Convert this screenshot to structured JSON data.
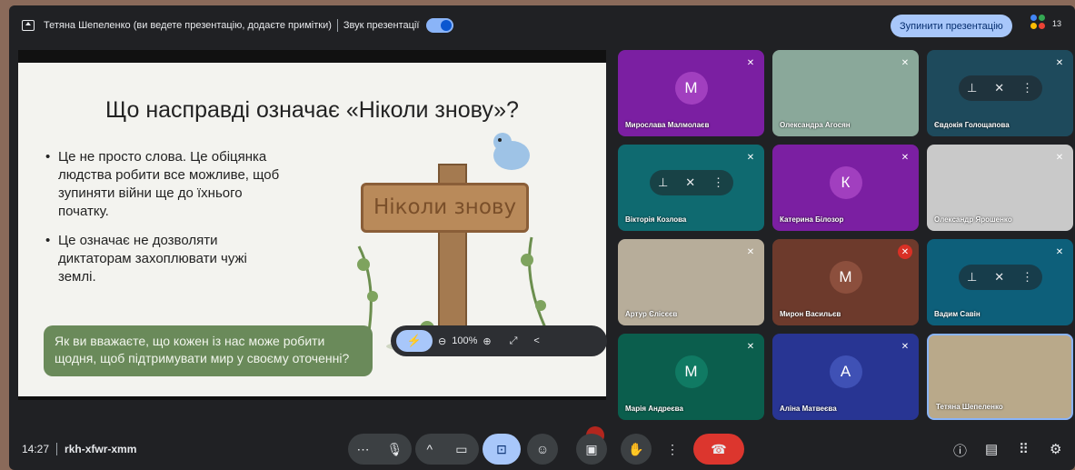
{
  "topbar": {
    "presenter_text": "Тетяна Шепеленко (ви ведете презентацію, додаєте примітки)",
    "sound_label": "Звук презентації",
    "stop_button": "Зупинити презентацію",
    "participant_count": "13"
  },
  "slide": {
    "title": "Що насправді означає «Ніколи знову»?",
    "bullets": [
      "Це не просто слова. Це обіцянка людства робити все можливе, щоб зупиняти війни ще до їхнього початку.",
      "Це означає не дозволяти диктаторам захоплювати чужі землі."
    ],
    "sign_text": "Ніколи знову",
    "question": "Як ви вважаєте, що кожен із нас може робити щодня, щоб підтримувати мир у своєму оточенні?"
  },
  "slide_toolbar": {
    "zoom": "100%"
  },
  "participants": [
    {
      "name": "Мирослава Малмолаєв",
      "initial": "М",
      "bg": "#7b1fa2",
      "avatar_bg": "#a13fbf"
    },
    {
      "name": "Олександра Агосян",
      "initial": "",
      "bg": "#8aa89a",
      "avatar_bg": ""
    },
    {
      "name": "Євдокія Голощапова",
      "initial": "",
      "bg": "#1e4a5c",
      "avatar_bg": ""
    },
    {
      "name": "Вікторія Козлова",
      "initial": "",
      "bg": "#0f6a70",
      "avatar_bg": ""
    },
    {
      "name": "Катерина Білозор",
      "initial": "К",
      "bg": "#7b1fa2",
      "avatar_bg": "#a13fbf"
    },
    {
      "name": "Олександр Ярошенко",
      "initial": "",
      "bg": "#c9c9c9",
      "avatar_bg": ""
    },
    {
      "name": "Артур Єлісєєв",
      "initial": "",
      "bg": "#b7ad9a",
      "avatar_bg": ""
    },
    {
      "name": "Мирон Васильєв",
      "initial": "М",
      "bg": "#6d3a2c",
      "avatar_bg": "#8c4f3d"
    },
    {
      "name": "Вадим Савін",
      "initial": "",
      "bg": "#0d5f7a",
      "avatar_bg": ""
    },
    {
      "name": "Марія Андреєва",
      "initial": "М",
      "bg": "#0b5e4d",
      "avatar_bg": "#107a63"
    },
    {
      "name": "Аліна Матвеєва",
      "initial": "А",
      "bg": "#283593",
      "avatar_bg": "#3f51b5"
    },
    {
      "name": "Тетяна Шепеленко",
      "initial": "",
      "bg": "#b9a98a",
      "avatar_bg": ""
    }
  ],
  "bottombar": {
    "time": "14:27",
    "meeting_code": "rkh-xfwr-xmm"
  },
  "colors": {
    "accent": "#a8c7fa",
    "end_call": "#dc362e",
    "bg": "#202124"
  }
}
